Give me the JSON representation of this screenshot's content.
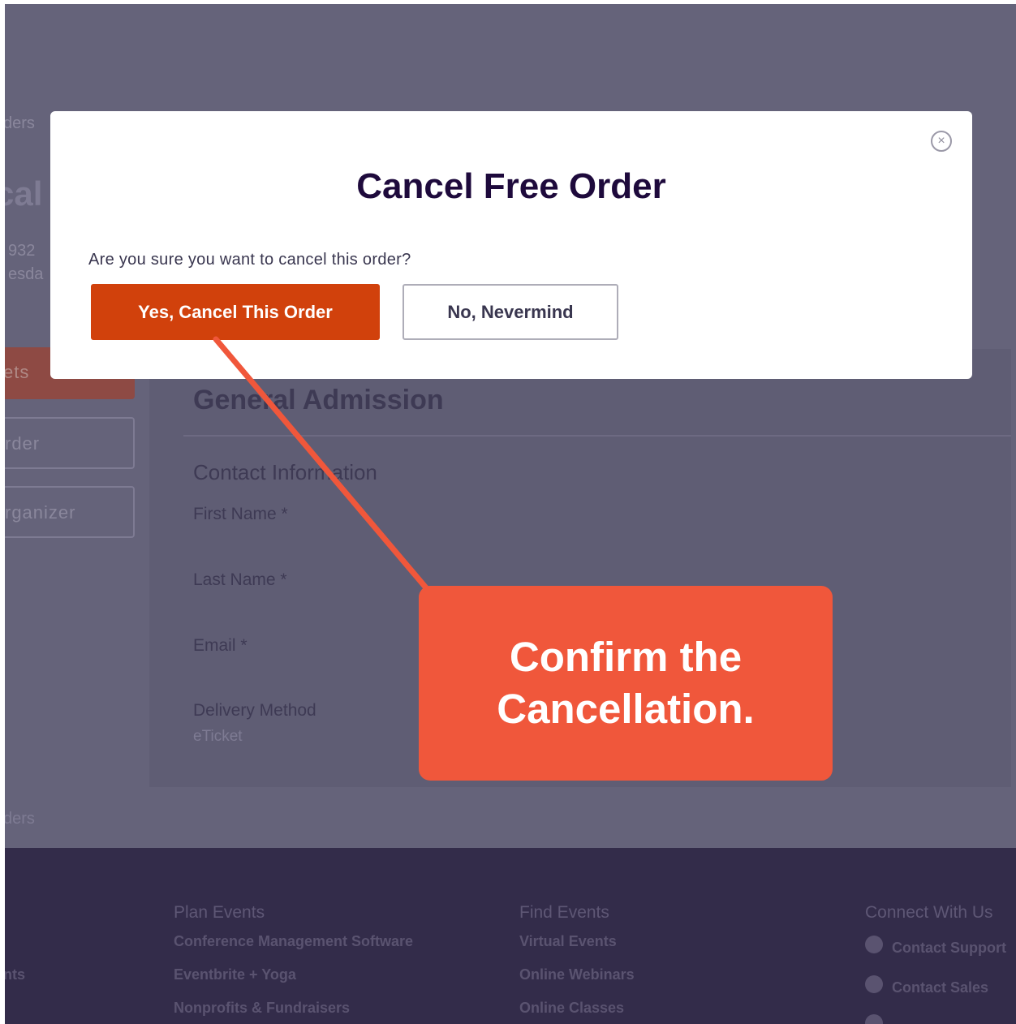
{
  "background": {
    "breadcrumb_top": "ders",
    "title_fragment": "cal",
    "order_number_fragment": "932",
    "date_fragment": "esda",
    "side_buttons": [
      "ets",
      "rder",
      "rganizer"
    ],
    "breadcrumb_bottom": "ders",
    "section_title": "General Admission",
    "contact_heading": "Contact Information",
    "fields": [
      "First Name *",
      "Last Name *",
      "Email *",
      "Delivery Method"
    ],
    "delivery_value": "eTicket"
  },
  "footer": {
    "left_fragment": "nts",
    "plan": {
      "heading": "Plan Events",
      "links": [
        "Conference Management Software",
        "Eventbrite + Yoga",
        "Nonprofits & Fundraisers"
      ]
    },
    "find": {
      "heading": "Find Events",
      "links": [
        "Virtual Events",
        "Online Webinars",
        "Online Classes"
      ]
    },
    "connect": {
      "heading": "Connect With Us",
      "links": [
        "Contact Support",
        "Contact Sales"
      ]
    }
  },
  "modal": {
    "title": "Cancel Free Order",
    "message": "Are you sure you want to cancel this order?",
    "confirm_label": "Yes, Cancel This Order",
    "cancel_label": "No, Nevermind",
    "close_icon": "×"
  },
  "annotation": {
    "text": "Confirm the Cancellation.",
    "color": "#f0573b"
  },
  "colors": {
    "primary": "#d1410c",
    "title": "#1e0a3c",
    "overlay": "#65637a",
    "footer": "#332c4a"
  }
}
